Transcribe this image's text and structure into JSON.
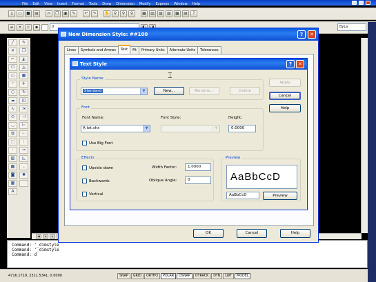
{
  "menu": [
    "File",
    "Edit",
    "View",
    "Insert",
    "Format",
    "Tools",
    "Draw",
    "Dimension",
    "Modify",
    "Express",
    "Window",
    "Help"
  ],
  "top_toolbar": {
    "layer_combo": "0",
    "right_combo": "ByLa"
  },
  "command_lines": [
    "Command: '_dimstyle",
    "Command: '_dimstyle",
    "Command: d"
  ],
  "status": {
    "coords": "4716.1719, 2311.5341, 0.0000",
    "buttons": [
      {
        "label": "SNAP",
        "on": false
      },
      {
        "label": "GRID",
        "on": false
      },
      {
        "label": "ORTHO",
        "on": false
      },
      {
        "label": "POLAR",
        "on": true
      },
      {
        "label": "OSNAP",
        "on": true
      },
      {
        "label": "OTRACK",
        "on": false
      },
      {
        "label": "DYN",
        "on": false
      },
      {
        "label": "LWT",
        "on": false
      },
      {
        "label": "MODEL",
        "on": true
      }
    ]
  },
  "dim_dialog": {
    "title": "New Dimension Style: ##100",
    "tabs": [
      "Lines",
      "Symbols and Arrows",
      "Text",
      "Fit",
      "Primary Units",
      "Alternate Units",
      "Tolerances"
    ],
    "active_tab": "Text",
    "ok": "OK",
    "cancel": "Cancel",
    "help": "Help"
  },
  "text_style": {
    "title": "Text Style",
    "style_name_group": "Style Name",
    "style_name_value": "Standard",
    "new_btn": "New...",
    "rename_btn": "Rename...",
    "delete_btn": "Delete",
    "apply_btn": "Apply",
    "cancel_btn": "Cancel",
    "help_btn": "Help",
    "font_group": "Font",
    "font_name_label": "Font Name:",
    "font_name_value": "txt.shx",
    "font_style_label": "Font Style:",
    "height_label": "Height:",
    "height_value": "0.0000",
    "big_font_label": "Use Big Font",
    "effects_group": "Effects",
    "upside_down": "Upside down",
    "backwards": "Backwards",
    "vertical": "Vertical",
    "width_factor_label": "Width Factor:",
    "width_factor_value": "1.0000",
    "oblique_label": "Oblique Angle:",
    "oblique_value": "0",
    "preview_group": "Preview",
    "preview_sample": "AaBbCcD",
    "preview_input": "AaBbCcD",
    "preview_btn": "Preview"
  }
}
